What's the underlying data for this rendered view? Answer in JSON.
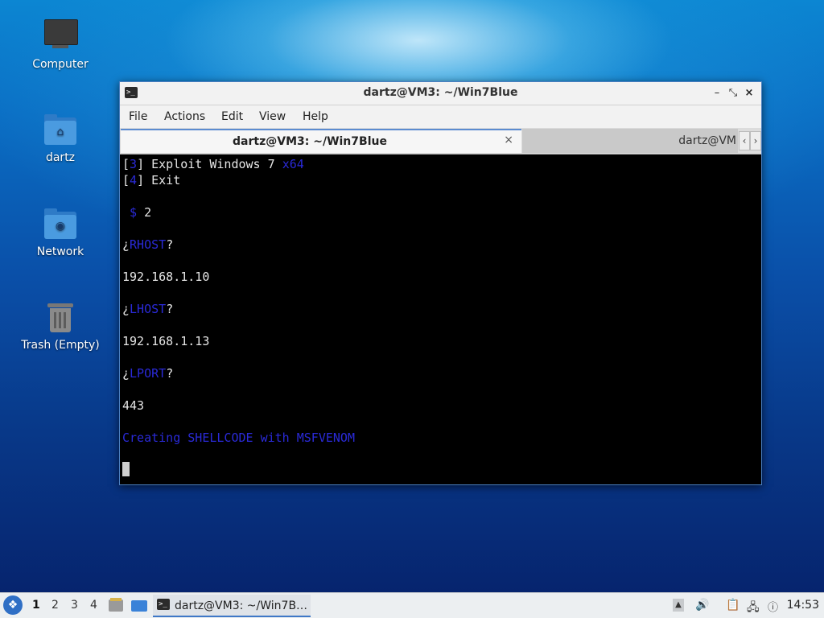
{
  "desktop": {
    "icons": [
      {
        "label": "Computer",
        "icon": "computer-icon"
      },
      {
        "label": "dartz",
        "icon": "home-folder-icon"
      },
      {
        "label": "Network",
        "icon": "network-folder-icon"
      },
      {
        "label": "Trash (Empty)",
        "icon": "trash-icon"
      }
    ]
  },
  "window": {
    "title": "dartz@VM3: ~/Win7Blue",
    "menu": [
      "File",
      "Actions",
      "Edit",
      "View",
      "Help"
    ],
    "tabs": [
      {
        "label": "dartz@VM3: ~/Win7Blue",
        "active": true
      },
      {
        "label": "dartz@VM",
        "active": false
      }
    ],
    "close_glyph": "×",
    "minimize_glyph": "–",
    "restore_glyph": "⤡",
    "tab_close_glyph": "×",
    "scroll_left_glyph": "‹",
    "scroll_right_glyph": "›"
  },
  "terminal": {
    "lines": {
      "l1_open": "[",
      "l1_num": "3",
      "l1_text": "] Exploit Windows 7 ",
      "l1_arch": "x64",
      "l2_open": "[",
      "l2_num": "4",
      "l2_text": "] Exit",
      "prompt_sym": " $",
      "prompt_val": " 2",
      "q1_open": "¿",
      "q1_key": "RHOST",
      "q1_close": "?",
      "a1": "192.168.1.10",
      "q2_open": "¿",
      "q2_key": "LHOST",
      "q2_close": "?",
      "a2": "192.168.1.13",
      "q3_open": "¿",
      "q3_key": "LPORT",
      "q3_close": "?",
      "a3": "443",
      "status": "Creating SHELLCODE with MSFVENOM"
    }
  },
  "taskbar": {
    "workspaces": [
      "1",
      "2",
      "3",
      "4"
    ],
    "active_workspace": "1",
    "task_label": "dartz@VM3: ~/Win7B…",
    "clock": "14:53",
    "terminal_icon_glyph": ">_"
  },
  "colors": {
    "accent": "#3f78c7",
    "terminal_bg": "#000000",
    "terminal_blue": "#2a2ad8"
  }
}
